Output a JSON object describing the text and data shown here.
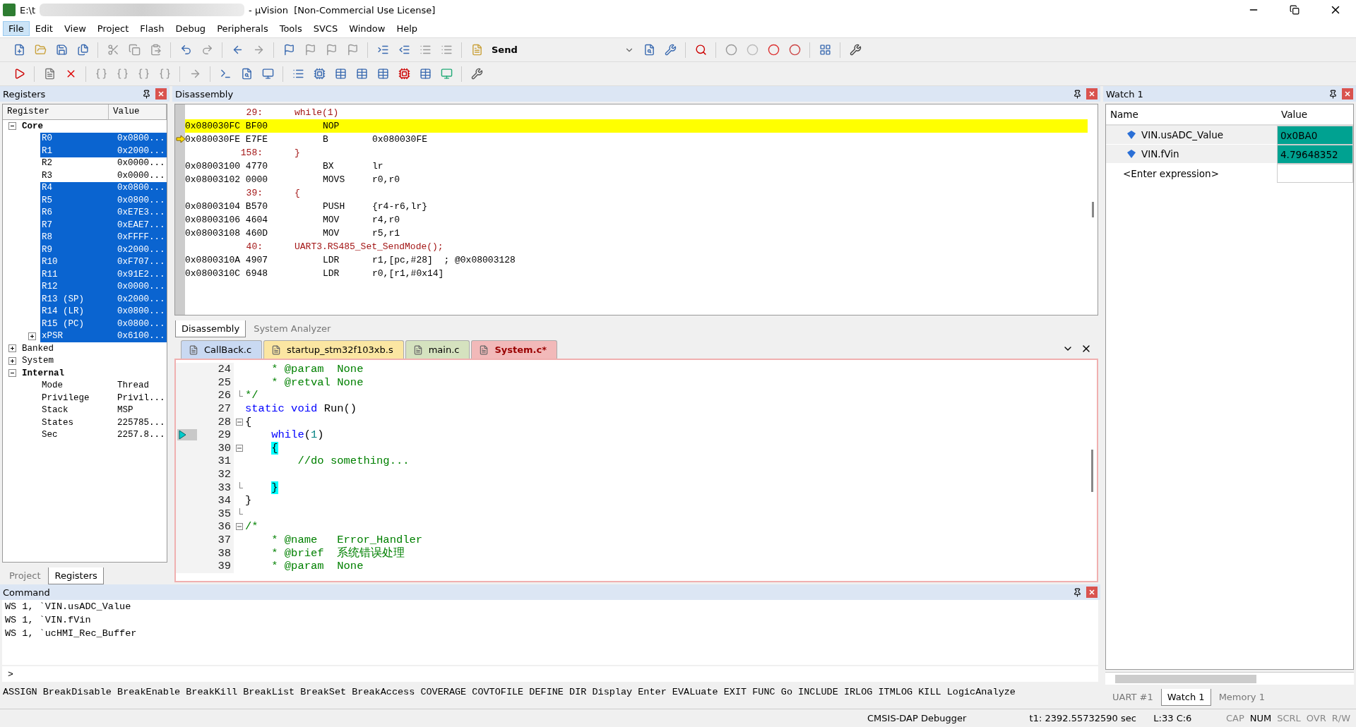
{
  "window": {
    "title_start": "E:\\t",
    "title_end": "- µVision  [Non-Commercial Use License]"
  },
  "menu": [
    {
      "label": "File",
      "selected": true
    },
    {
      "label": "Edit",
      "selected": false
    },
    {
      "label": "View",
      "selected": false
    },
    {
      "label": "Project",
      "selected": false
    },
    {
      "label": "Flash",
      "selected": false
    },
    {
      "label": "Debug",
      "selected": false
    },
    {
      "label": "Peripherals",
      "selected": false
    },
    {
      "label": "Tools",
      "selected": false
    },
    {
      "label": "SVCS",
      "selected": false
    },
    {
      "label": "Window",
      "selected": false
    },
    {
      "label": "Help",
      "selected": false
    }
  ],
  "toolbar": {
    "target": "Send"
  },
  "registers": {
    "title": "Registers",
    "columns": [
      "Register",
      "Value"
    ],
    "tree": [
      {
        "name": "Core",
        "expanded": true,
        "selected": false,
        "children": [
          {
            "name": "R0",
            "value": "0x0800...",
            "selected": true
          },
          {
            "name": "R1",
            "value": "0x2000...",
            "selected": true
          },
          {
            "name": "R2",
            "value": "0x0000...",
            "selected": false
          },
          {
            "name": "R3",
            "value": "0x0000...",
            "selected": false
          },
          {
            "name": "R4",
            "value": "0x0800...",
            "selected": true
          },
          {
            "name": "R5",
            "value": "0x0800...",
            "selected": true
          },
          {
            "name": "R6",
            "value": "0xE7E3...",
            "selected": true
          },
          {
            "name": "R7",
            "value": "0xEAE7...",
            "selected": true
          },
          {
            "name": "R8",
            "value": "0xFFFF...",
            "selected": true
          },
          {
            "name": "R9",
            "value": "0x2000...",
            "selected": true
          },
          {
            "name": "R10",
            "value": "0xF707...",
            "selected": true
          },
          {
            "name": "R11",
            "value": "0x91E2...",
            "selected": true
          },
          {
            "name": "R12",
            "value": "0x0000...",
            "selected": true
          },
          {
            "name": "R13 (SP)",
            "value": "0x2000...",
            "selected": true
          },
          {
            "name": "R14 (LR)",
            "value": "0x0800...",
            "selected": true
          },
          {
            "name": "R15 (PC)",
            "value": "0x0800...",
            "selected": true
          },
          {
            "name": "xPSR",
            "value": "0x6100...",
            "selected": true,
            "expanded": false
          }
        ]
      },
      {
        "name": "Banked",
        "expanded": false,
        "selected": false
      },
      {
        "name": "System",
        "expanded": false,
        "selected": false
      },
      {
        "name": "Internal",
        "expanded": true,
        "selected": false,
        "children": [
          {
            "name": "Mode",
            "value": "Thread",
            "selected": false
          },
          {
            "name": "Privilege",
            "value": "Privil...",
            "selected": false
          },
          {
            "name": "Stack",
            "value": "MSP",
            "selected": false
          },
          {
            "name": "States",
            "value": "225785...",
            "selected": false
          },
          {
            "name": "Sec",
            "value": "2257.8...",
            "selected": false
          }
        ]
      }
    ],
    "tabs": [
      {
        "label": "Project",
        "selected": false
      },
      {
        "label": "Registers",
        "selected": true
      }
    ]
  },
  "disassembly": {
    "title": "Disassembly",
    "lines": [
      {
        "kind": "source",
        "number": "29:",
        "code": "while(1)"
      },
      {
        "kind": "asm",
        "address": "0x080030FC",
        "opcode": "BF00",
        "mnemonic": "NOP",
        "highlighted": true,
        "pc": false
      },
      {
        "kind": "asm",
        "address": "0x080030FE",
        "opcode": "E7FE",
        "mnemonic": "B",
        "operands": "0x080030FE",
        "highlighted": false,
        "pc": true
      },
      {
        "kind": "source",
        "number": "158:",
        "code": "}"
      },
      {
        "kind": "asm",
        "address": "0x08003100",
        "opcode": "4770",
        "mnemonic": "BX",
        "operands": "lr",
        "highlighted": false,
        "pc": false
      },
      {
        "kind": "asm",
        "address": "0x08003102",
        "opcode": "0000",
        "mnemonic": "MOVS",
        "operands": "r0,r0",
        "highlighted": false,
        "pc": false
      },
      {
        "kind": "source",
        "number": "39:",
        "code": "{"
      },
      {
        "kind": "asm",
        "address": "0x08003104",
        "opcode": "B570",
        "mnemonic": "PUSH",
        "operands": "{r4-r6,lr}",
        "highlighted": false,
        "pc": false
      },
      {
        "kind": "asm",
        "address": "0x08003106",
        "opcode": "4604",
        "mnemonic": "MOV",
        "operands": "r4,r0",
        "highlighted": false,
        "pc": false
      },
      {
        "kind": "asm",
        "address": "0x08003108",
        "opcode": "460D",
        "mnemonic": "MOV",
        "operands": "r5,r1",
        "highlighted": false,
        "pc": false
      },
      {
        "kind": "source",
        "number": "40:",
        "code": "UART3.RS485_Set_SendMode();"
      },
      {
        "kind": "asm",
        "address": "0x0800310A",
        "opcode": "4907",
        "mnemonic": "LDR",
        "operands": "r1,[pc,#28]  ; @0x08003128",
        "highlighted": false,
        "pc": false
      },
      {
        "kind": "asm",
        "address": "0x0800310C",
        "opcode": "6948",
        "mnemonic": "LDR",
        "operands": "r0,[r1,#0x14]",
        "highlighted": false,
        "pc": false
      }
    ],
    "tabs": [
      {
        "label": "Disassembly",
        "selected": true
      },
      {
        "label": "System Analyzer",
        "selected": false
      }
    ]
  },
  "editor": {
    "tabs": [
      {
        "label": "CallBack.c",
        "selected": false,
        "color": "#c9d9f2"
      },
      {
        "label": "startup_stm32f103xb.s",
        "selected": false,
        "color": "#fbe6a2"
      },
      {
        "label": "main.c",
        "selected": false,
        "color": "#d5e2bf"
      },
      {
        "label": "System.c*",
        "selected": true,
        "color": "#f2b9b9"
      }
    ],
    "lines": [
      {
        "number": "24",
        "kind": "code",
        "current": false,
        "segments": [
          {
            "kind": "comment",
            "text": "    * @param  None"
          }
        ]
      },
      {
        "number": "25",
        "kind": "code",
        "current": false,
        "segments": [
          {
            "kind": "comment",
            "text": "    * @retval None"
          }
        ]
      },
      {
        "number": "26",
        "kind": "fold-end",
        "current": false,
        "segments": [
          {
            "kind": "comment",
            "text": "*/"
          }
        ]
      },
      {
        "number": "27",
        "kind": "code",
        "current": false,
        "segments": [
          {
            "kind": "keyword",
            "text": "static void"
          },
          {
            "kind": "plain",
            "text": " Run()"
          }
        ]
      },
      {
        "number": "28",
        "kind": "fold-start",
        "current": false,
        "segments": [
          {
            "kind": "plain",
            "text": "{"
          }
        ]
      },
      {
        "number": "29",
        "kind": "code",
        "current": true,
        "segments": [
          {
            "kind": "keyword",
            "text": "    while"
          },
          {
            "kind": "plain",
            "text": "("
          },
          {
            "kind": "number",
            "text": "1"
          },
          {
            "kind": "plain",
            "text": ")"
          }
        ]
      },
      {
        "number": "30",
        "kind": "fold-start",
        "current": false,
        "segments": [
          {
            "kind": "brace",
            "text": "    {"
          }
        ]
      },
      {
        "number": "31",
        "kind": "code",
        "current": false,
        "segments": [
          {
            "kind": "comment",
            "text": "        //do something..."
          }
        ]
      },
      {
        "number": "32",
        "kind": "code",
        "current": false
      },
      {
        "number": "33",
        "kind": "fold-end",
        "current": false,
        "segments": [
          {
            "kind": "brace",
            "text": "    }"
          }
        ]
      },
      {
        "number": "34",
        "kind": "code",
        "current": false,
        "segments": [
          {
            "kind": "plain",
            "text": "}"
          }
        ]
      },
      {
        "number": "35",
        "kind": "fold-end",
        "current": false
      },
      {
        "number": "36",
        "kind": "fold-start",
        "current": false,
        "segments": [
          {
            "kind": "comment",
            "text": "/*"
          }
        ]
      },
      {
        "number": "37",
        "kind": "code",
        "current": false,
        "segments": [
          {
            "kind": "comment",
            "text": "    * @name   Error_Handler"
          }
        ]
      },
      {
        "number": "38",
        "kind": "code",
        "current": false,
        "segments": [
          {
            "kind": "comment",
            "text": "    * @brief  系统错误处理"
          }
        ]
      },
      {
        "number": "39",
        "kind": "code",
        "current": false,
        "segments": [
          {
            "kind": "comment",
            "text": "    * @param  None"
          }
        ]
      }
    ]
  },
  "watch": {
    "title": "Watch 1",
    "columns": [
      "Name",
      "Value"
    ],
    "rows": [
      {
        "name": "VIN.usADC_Value",
        "value": "0x0BA0",
        "changed": true
      },
      {
        "name": "VIN.fVin",
        "value": "4.79648352",
        "changed": true
      }
    ],
    "enter": "<Enter expression>",
    "tabs": [
      {
        "label": "UART #1",
        "selected": false
      },
      {
        "label": "Watch 1",
        "selected": true
      },
      {
        "label": "Memory 1",
        "selected": false
      }
    ]
  },
  "command": {
    "title": "Command",
    "lines": [
      "WS 1, `VIN.usADC_Value",
      "WS 1, `VIN.fVin",
      "WS 1, `ucHMI_Rec_Buffer"
    ],
    "prompt": ">",
    "keywords": "ASSIGN BreakDisable BreakEnable BreakKill BreakList BreakSet BreakAccess COVERAGE COVTOFILE DEFINE DIR Display Enter EVALuate EXIT FUNC Go INCLUDE IRLOG ITMLOG KILL LogicAnalyze"
  },
  "status_bar": {
    "debugger": "CMSIS-DAP Debugger",
    "time": "t1: 2392.55732590 sec",
    "position": "L:33 C:6",
    "indicators": [
      {
        "label": "CAP",
        "on": false
      },
      {
        "label": "NUM",
        "on": true
      },
      {
        "label": "SCRL",
        "on": false
      },
      {
        "label": "OVR",
        "on": false
      },
      {
        "label": "R/W",
        "on": false
      }
    ]
  }
}
